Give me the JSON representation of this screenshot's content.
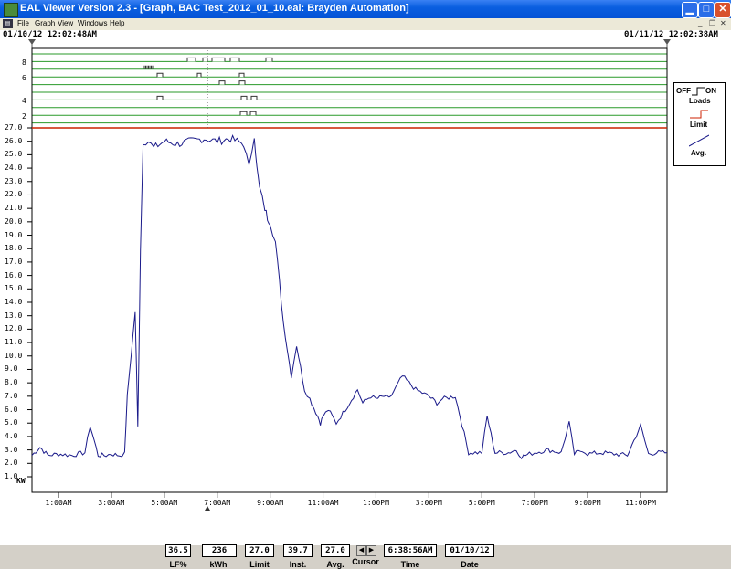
{
  "window": {
    "title": "EAL Viewer Version 2.3 - [Graph, BAC Test_2012_01_10.eal: Brayden Automation]",
    "icons": {
      "minimize": "minimize-icon",
      "maximize": "maximize-icon",
      "close": "close-icon"
    }
  },
  "menu": {
    "items": [
      "File",
      "Graph",
      "View",
      "Windows",
      "Help"
    ]
  },
  "graph": {
    "start_time": "01/10/12 12:02:48AM",
    "end_time": "01/11/12 12:02:38AM",
    "y_ticks": [
      "27.0",
      "26.0",
      "25.0",
      "24.0",
      "23.0",
      "22.0",
      "21.0",
      "20.0",
      "19.0",
      "18.0",
      "17.0",
      "16.0",
      "15.0",
      "14.0",
      "13.0",
      "12.0",
      "11.0",
      "10.0",
      "9.0",
      "8.0",
      "7.0",
      "6.0",
      "5.0",
      "4.0",
      "3.0",
      "2.0",
      "1.0"
    ],
    "y_unit": "KW",
    "load_ticks": [
      "8",
      "6",
      "4",
      "2"
    ],
    "x_ticks": [
      "1:00AM",
      "3:00AM",
      "5:00AM",
      "7:00AM",
      "9:00AM",
      "11:00AM",
      "1:00PM",
      "3:00PM",
      "5:00PM",
      "7:00PM",
      "9:00PM",
      "11:00PM"
    ]
  },
  "legend": {
    "off": "OFF",
    "on": "ON",
    "loads": "Loads",
    "limit": "Limit",
    "avg": "Avg."
  },
  "status": {
    "lf_value": "36.5",
    "lf_label": "LF%",
    "kwh_value": "236",
    "kwh_label": "kWh",
    "limit_value": "27.0",
    "limit_label": "Limit",
    "inst_value": "39.7",
    "inst_label": "Inst.",
    "avg_value": "27.0",
    "avg_label": "Avg.",
    "cursor_label": "Cursor",
    "time_value": "6:38:56AM",
    "time_label": "Time",
    "date_value": "01/10/12",
    "date_label": "Date"
  },
  "chart_data": {
    "type": "line",
    "xlabel": "",
    "ylabel": "KW",
    "ylim": [
      0.5,
      27.2
    ],
    "limit": 27.0,
    "series": [
      {
        "x_hours": [
          0,
          0.3,
          0.6,
          1.0,
          1.5,
          2.0,
          2.2,
          2.5,
          2.8,
          3.0,
          3.3,
          3.5,
          3.6,
          3.9,
          4.0,
          4.1,
          4.2,
          4.4,
          4.6,
          5.0,
          5.5,
          6.0,
          6.5,
          7.0,
          7.5,
          8.0,
          8.2,
          8.4,
          8.5,
          8.6,
          8.8,
          8.9,
          9.0,
          9.2,
          9.5,
          9.8,
          10.0,
          10.3,
          10.5,
          10.8,
          10.9,
          11.0,
          11.2,
          11.5,
          12.0,
          12.3,
          12.5,
          12.8,
          13.0,
          13.3,
          13.5,
          14.0,
          14.5,
          15.0,
          15.3,
          15.5,
          16.0,
          16.5,
          17.0,
          17.2,
          17.5,
          18.0,
          18.3,
          18.5,
          18.8,
          19.0,
          19.5,
          20.0,
          20.3,
          20.5,
          20.8,
          21.0,
          21.5,
          22.0,
          22.5,
          23.0,
          23.3,
          23.6,
          24.0
        ],
        "y_kw": [
          2.6,
          3.2,
          2.6,
          2.7,
          2.6,
          2.8,
          4.8,
          2.6,
          2.6,
          2.7,
          2.6,
          2.7,
          7.0,
          13.3,
          4.7,
          18.0,
          26.0,
          26.0,
          25.5,
          26.0,
          25.8,
          26.0,
          26.2,
          26.0,
          26.2,
          25.8,
          24.0,
          26.5,
          24.0,
          22.5,
          21.0,
          20.3,
          20.0,
          18.5,
          12.5,
          8.5,
          10.8,
          7.5,
          6.8,
          5.5,
          5.0,
          5.5,
          6.0,
          5.0,
          6.5,
          7.5,
          6.5,
          7.0,
          6.8,
          7.0,
          6.8,
          8.5,
          7.5,
          7.0,
          6.5,
          6.8,
          7.0,
          2.8,
          2.8,
          5.5,
          2.8,
          2.8,
          3.0,
          2.5,
          2.7,
          2.8,
          3.0,
          2.8,
          5.0,
          2.7,
          3.0,
          2.7,
          2.8,
          2.7,
          2.6,
          4.8,
          2.7,
          2.8,
          2.8
        ]
      }
    ]
  }
}
